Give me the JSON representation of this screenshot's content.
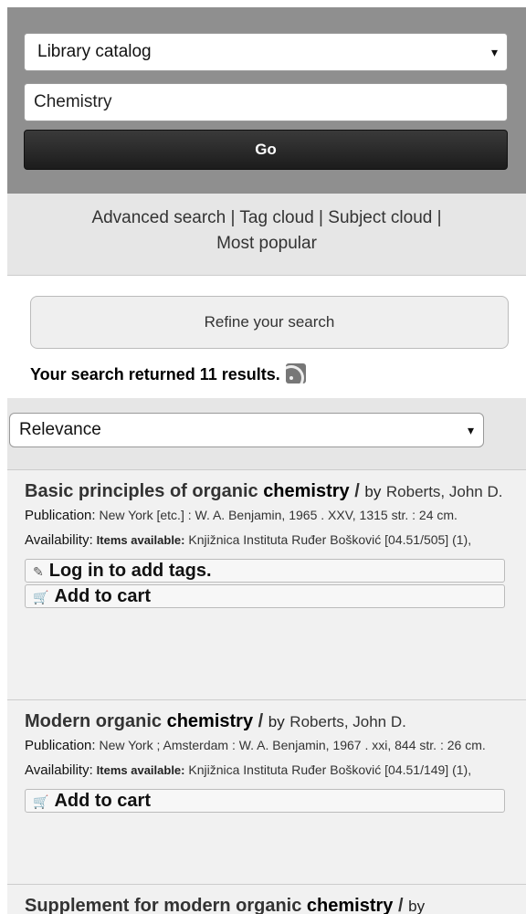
{
  "search": {
    "library_select": "Library catalog",
    "query": "Chemistry",
    "go_label": "Go"
  },
  "links": {
    "advanced": "Advanced search",
    "tag_cloud": "Tag cloud",
    "subject_cloud": "Subject cloud",
    "most_popular": "Most popular",
    "separator": "|"
  },
  "refine": {
    "label": "Refine your search",
    "results_text": "Your search returned 11 results."
  },
  "sort": {
    "selected": "Relevance"
  },
  "results": [
    {
      "title_pre": "Basic principles of organic ",
      "title_hl": "chemistry",
      "title_post": " /",
      "by": "by",
      "author": "Roberts, John D.",
      "pub_label": "Publication:",
      "pub_text": "New York [etc.] : W. A. Benjamin, 1965 . XXV, 1315 str. : 24 cm.",
      "avail_label": "Availability:",
      "avail_bold": "Items available:",
      "avail_text": "Knjižnica Instituta Ruđer Bošković [04.51/505] (1),",
      "tags_label": "Log in to add tags.",
      "cart_label": "Add to cart"
    },
    {
      "title_pre": "Modern organic ",
      "title_hl": "chemistry",
      "title_post": " /",
      "by": "by",
      "author": "Roberts, John D.",
      "pub_label": "Publication:",
      "pub_text": "New York ; Amsterdam : W. A. Benjamin, 1967 . xxi, 844 str. : 26 cm.",
      "avail_label": "Availability:",
      "avail_bold": "Items available:",
      "avail_text": "Knjižnica Instituta Ruđer Bošković [04.51/149] (1),",
      "cart_label": "Add to cart"
    },
    {
      "title_pre": "Supplement for modern organic ",
      "title_hl": "chemistry",
      "title_post": " /",
      "by": "by"
    }
  ],
  "icons": {
    "select_arrow": "▾",
    "tag_icon": "✎",
    "cart_icon": "🛒"
  },
  "colors": {
    "search_panel_bg": "#8f8f8f",
    "go_button_bg": "#2a2a2a",
    "bar_bg": "#e6e6e6",
    "result_bg": "#f1f1f1"
  }
}
